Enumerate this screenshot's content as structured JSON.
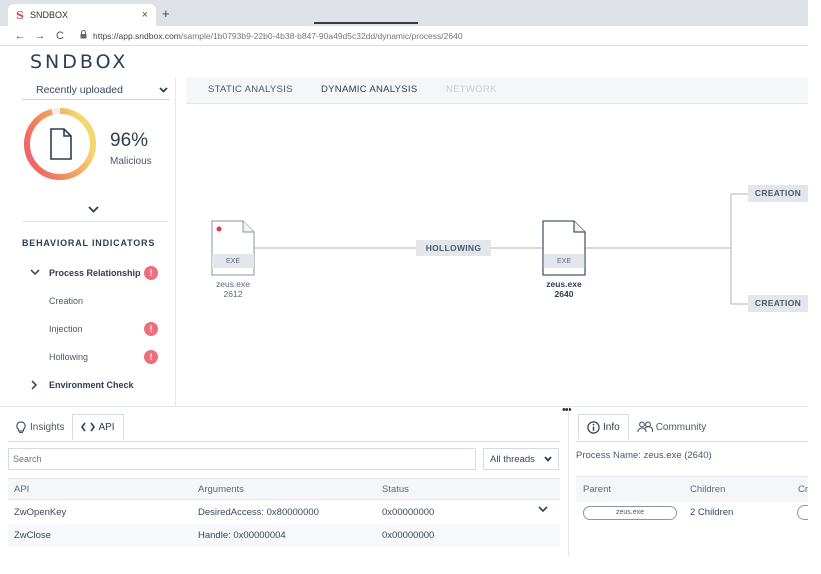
{
  "browser": {
    "tab_title": "SNDBOX",
    "tab_favicon": "S",
    "close_glyph": "×",
    "new_tab_glyph": "+",
    "back_glyph": "←",
    "forward_glyph": "→",
    "reload_glyph": "C",
    "lock_glyph": "🔒",
    "url_host": "https://app.sndbox.com",
    "url_path": "/sample/1b0793b9-22b0-4b38-b847-90a49d5c32dd/dynamic/process/2640"
  },
  "app": {
    "logo": "SNDBOX"
  },
  "sidebar": {
    "selector_label": "Recently uploaded",
    "score_percent": "96%",
    "score_value": 0.96,
    "score_label": "Malicious",
    "section_title": "BEHAVIORAL INDICATORS",
    "items": [
      {
        "label": "Process Relationship",
        "expanded": true,
        "badge": "!"
      },
      {
        "label": "Creation"
      },
      {
        "label": "Injection",
        "badge": "!"
      },
      {
        "label": "Hollowing",
        "badge": "!"
      },
      {
        "label": "Environment Check",
        "expanded": false
      }
    ]
  },
  "main_tabs": [
    {
      "label": "STATIC ANALYSIS",
      "state": "normal"
    },
    {
      "label": "DYNAMIC ANALYSIS",
      "state": "active"
    },
    {
      "label": "NETWORK",
      "state": "disabled"
    }
  ],
  "graph": {
    "nodes": [
      {
        "type": "EXE",
        "name": "zeus.exe",
        "pid": "2612",
        "highlight": false
      },
      {
        "type": "EXE",
        "name": "zeus.exe",
        "pid": "2640",
        "highlight": true
      }
    ],
    "edges": [
      {
        "label": "HOLLOWING"
      },
      {
        "label": "CREATION"
      },
      {
        "label": "CREATION"
      }
    ]
  },
  "splitter_glyph": "•••",
  "api_panel": {
    "tabs": [
      {
        "label": "Insights",
        "icon": "lightbulb-icon"
      },
      {
        "label": "API",
        "icon": "code-icon"
      }
    ],
    "search_placeholder": "Search",
    "thread_filter": "All threads",
    "columns": [
      "API",
      "Arguments",
      "Status"
    ],
    "rows": [
      {
        "api": "ZwOpenKey",
        "arguments": "DesiredAccess: 0x80000000",
        "status": "0x00000000"
      },
      {
        "api": "ZwClose",
        "arguments": "Handle: 0x00000004",
        "status": "0x00000000"
      }
    ]
  },
  "info_panel": {
    "tabs": [
      {
        "label": "Info",
        "icon": "info-icon"
      },
      {
        "label": "Community",
        "icon": "people-icon"
      }
    ],
    "process_name": "Process Name: zeus.exe (2640)",
    "columns": [
      "Parent",
      "Children",
      "Cr"
    ],
    "parent_value": "zeus.exe",
    "children_value": "2 Children"
  },
  "colors": {
    "accent": "#2c3e50",
    "badge": "#f06d7c",
    "gauge_start": "#f0536a",
    "gauge_end": "#f5d76e"
  }
}
